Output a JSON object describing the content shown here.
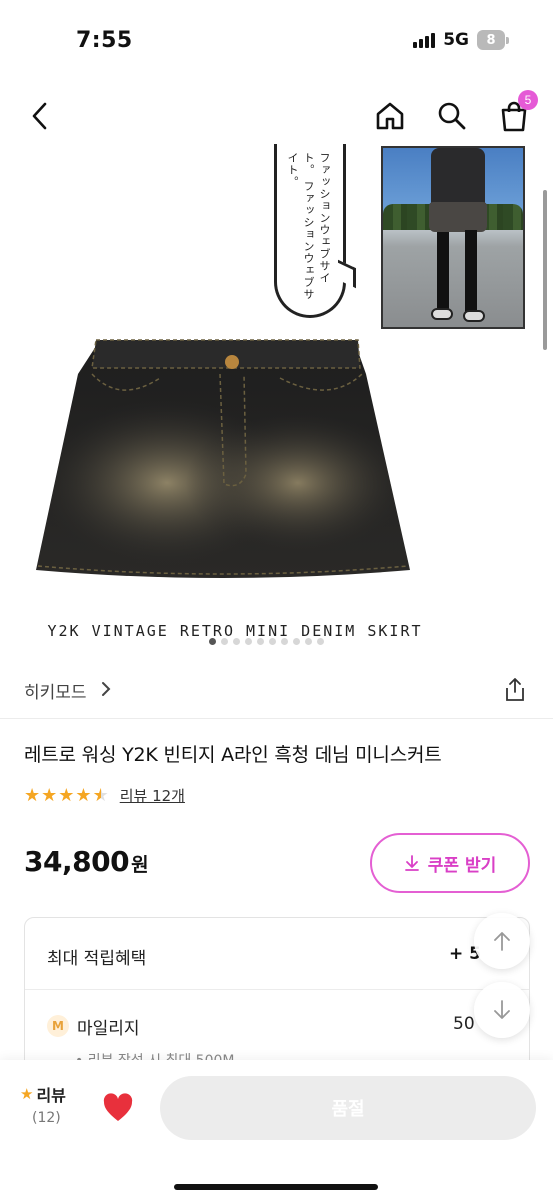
{
  "status_bar": {
    "time": "7:55",
    "network": "5G",
    "battery": "8"
  },
  "top_nav": {
    "cart_count": "5"
  },
  "carousel": {
    "bubble_text_1": "ファッションウェブサイト。",
    "bubble_text_2": "ファッションウェブサイト。",
    "caption": "Y2K VINTAGE RETRO MINI DENIM SKIRT",
    "dot_count": 10,
    "active_dot": 0
  },
  "brand": {
    "name": "히키모드"
  },
  "product": {
    "title": "레트로 워싱 Y2K 빈티지 A라인 흑청 데님 미니스커트",
    "rating": 4.5,
    "review_link": "리뷰 12개",
    "price": "34,800",
    "price_unit": "원",
    "coupon_label": "쿠폰 받기"
  },
  "benefits": {
    "title": "최대 적립혜택",
    "total": "+ 5",
    "mileage_icon": "M",
    "mileage_label": "마일리지",
    "mileage_value": "50",
    "mileage_note": "• 리뷰 작성 시 최대 500M"
  },
  "bottom_bar": {
    "review_label": "리뷰",
    "review_count": "(12)",
    "soldout_label": "품절"
  },
  "colors": {
    "accent": "#e45fd3",
    "star": "#f5a623",
    "heart": "#e8303c"
  }
}
